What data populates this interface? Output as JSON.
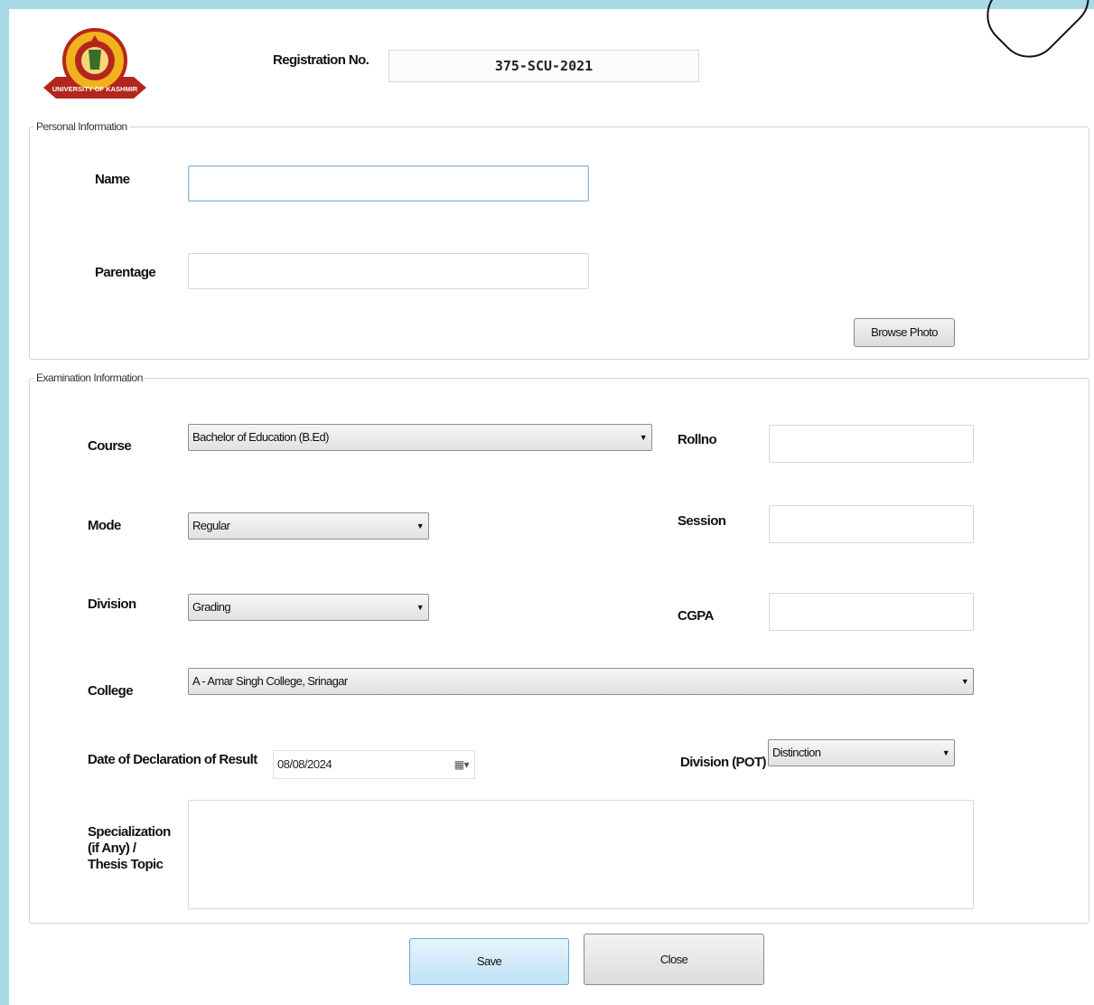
{
  "header": {
    "registration_label": "Registration No.",
    "registration_value": "375-SCU-2021",
    "logo_text": "UNIVERSITY OF KASHMIR"
  },
  "personal": {
    "legend": "Personal Information",
    "name_label": "Name",
    "name_value": "",
    "parentage_label": "Parentage",
    "parentage_value": "",
    "browse_label": "Browse Photo"
  },
  "exam": {
    "legend": "Examination Information",
    "course_label": "Course",
    "course_value": "Bachelor of Education (B.Ed)",
    "rollno_label": "Rollno",
    "mode_label": "Mode",
    "mode_value": "Regular",
    "session_label": "Session",
    "division_label": "Division",
    "division_value": "Grading",
    "cgpa_label": "CGPA",
    "college_label": "College",
    "college_value": "A  - Amar Singh College, Srinagar",
    "date_label": "Date of Declaration of Result",
    "date_value": "08/08/2024",
    "division_pot_label": "Division (POT)",
    "division_pot_value": "Distinction",
    "specialization_label_1": "Specialization",
    "specialization_label_2": "(if Any) /",
    "specialization_label_3": "Thesis Topic"
  },
  "footer": {
    "save_label": "Save",
    "close_label": "Close"
  },
  "colors": {
    "page_background": "#a9d9e6",
    "save_button": "#bfe1f6"
  }
}
